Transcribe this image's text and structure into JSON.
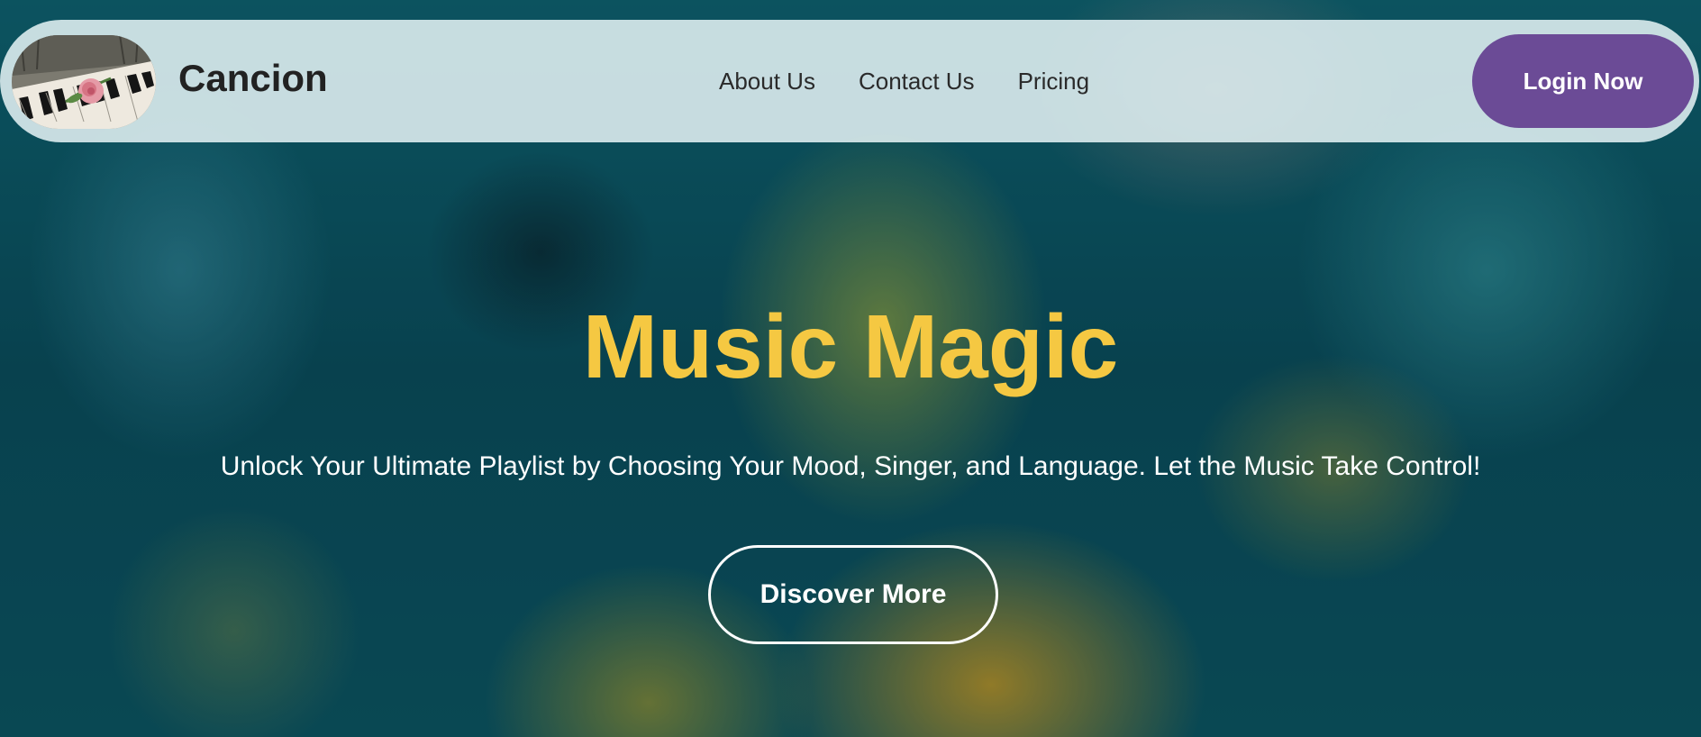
{
  "navbar": {
    "brand": "Cancion",
    "logo_icon": "piano-rose-icon",
    "links": [
      {
        "label": "About Us"
      },
      {
        "label": "Contact Us"
      },
      {
        "label": "Pricing"
      }
    ],
    "login_label": "Login Now"
  },
  "hero": {
    "title": "Music Magic",
    "subtitle": "Unlock Your Ultimate Playlist by Choosing Your Mood, Singer, and Language. Let the Music Take Control!",
    "cta_label": "Discover More"
  },
  "colors": {
    "accent_yellow": "#f5c842",
    "login_purple": "#6b4b96",
    "navbar_bg": "#e1f0f2"
  }
}
